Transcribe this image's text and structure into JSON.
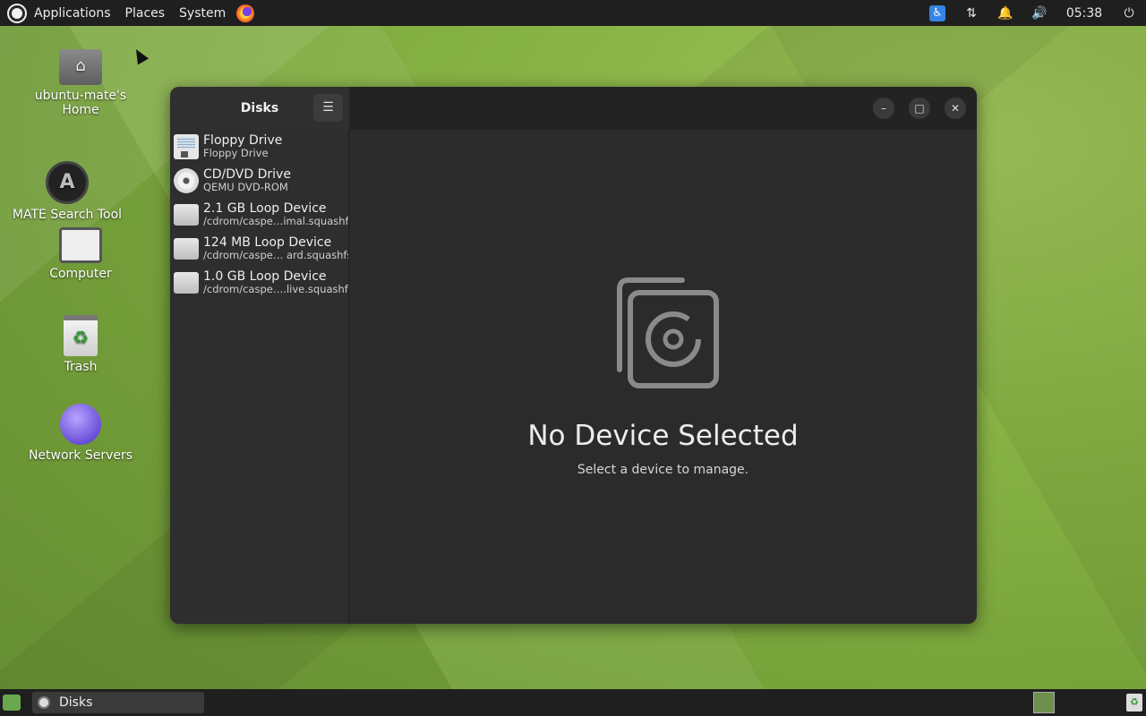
{
  "top_panel": {
    "menus": [
      "Applications",
      "Places",
      "System"
    ],
    "clock": "05:38"
  },
  "desktop": {
    "icons": [
      {
        "label": "ubuntu-mate's Home"
      },
      {
        "label": "MATE Search Tool"
      },
      {
        "label": "Computer"
      },
      {
        "label": "Trash"
      },
      {
        "label": "Network Servers"
      }
    ]
  },
  "window": {
    "sidebar_title": "Disks",
    "devices": [
      {
        "name": "Floppy Drive",
        "sub": "Floppy Drive",
        "icon": "floppy-icon"
      },
      {
        "name": "CD/DVD Drive",
        "sub": "QEMU DVD-ROM",
        "icon": "cd-icon"
      },
      {
        "name": "2.1 GB Loop Device",
        "sub": "/cdrom/caspe…imal.squashfs",
        "icon": "drive-icon"
      },
      {
        "name": "124 MB Loop Device",
        "sub": "/cdrom/caspe… ard.squashfs",
        "icon": "drive-icon"
      },
      {
        "name": "1.0 GB Loop Device",
        "sub": "/cdrom/caspe….live.squashfs",
        "icon": "drive-icon"
      }
    ],
    "empty_title": "No Device Selected",
    "empty_sub": "Select a device to manage."
  },
  "bottom_panel": {
    "task_label": "Disks"
  },
  "colors": {
    "panel": "#1f1f1f",
    "window_bg": "#2b2b2b",
    "accent": "#3584e4"
  }
}
